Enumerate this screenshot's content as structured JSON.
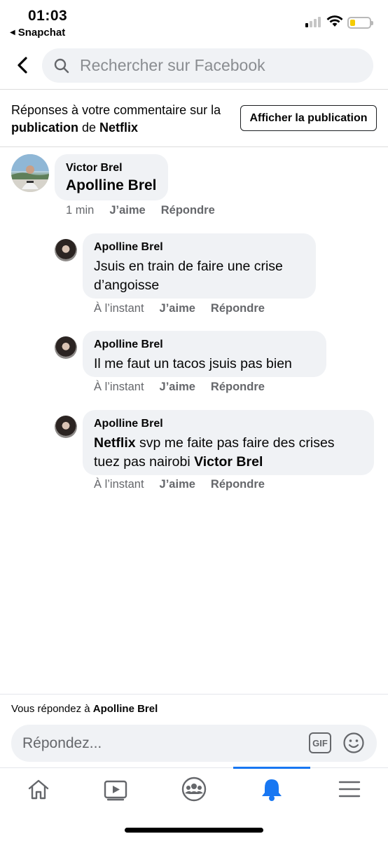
{
  "status_bar": {
    "time": "01:03",
    "back_app": "Snapchat"
  },
  "search": {
    "placeholder": "Rechercher sur Facebook"
  },
  "context": {
    "text_prefix": "Réponses à votre commentaire sur la ",
    "text_bold_1": "publication",
    "text_middle": " de ",
    "text_bold_2": "Netflix",
    "button_label": "Afficher la publication"
  },
  "comments": [
    {
      "author": "Victor Brel",
      "text": "Apolline Brel",
      "time": "1 min",
      "like": "J’aime",
      "reply": "Répondre"
    },
    {
      "author": "Apolline Brel",
      "text": "Jsuis en train de faire une crise d’angoisse",
      "time": "À l’instant",
      "like": "J’aime",
      "reply": "Répondre"
    },
    {
      "author": "Apolline Brel",
      "text": "Il me faut un tacos jsuis pas bien",
      "time": "À l’instant",
      "like": "J’aime",
      "reply": "Répondre"
    },
    {
      "author": "Apolline Brel",
      "text_bold_1": "Netflix",
      "text_middle": " svp me faite pas faire des crises tuez pas nairobi ",
      "text_bold_2": "Victor Brel",
      "time": "À l’instant",
      "like": "J’aime",
      "reply": "Répondre"
    }
  ],
  "reply_bar": {
    "label_prefix": "Vous répondez à ",
    "label_name": "Apolline Brel",
    "placeholder": "Répondez...",
    "gif_label": "GIF"
  },
  "bottom_nav": {
    "items": [
      "home-icon",
      "watch-icon",
      "groups-icon",
      "notifications-icon",
      "menu-icon"
    ],
    "active": "notifications-icon"
  },
  "colors": {
    "accent": "#1877f2",
    "bubble": "#f0f2f5",
    "secondary_text": "#65676b"
  }
}
